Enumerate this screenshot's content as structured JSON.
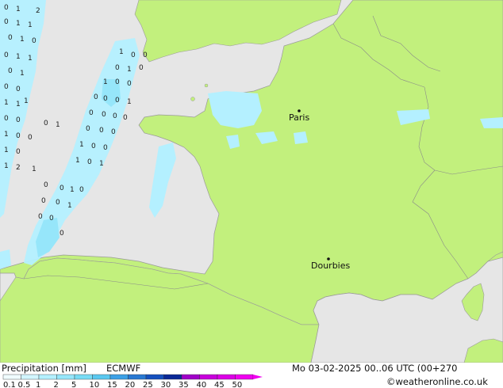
{
  "map": {
    "cities": [
      {
        "name": "Paris"
      },
      {
        "name": "Dourbies"
      }
    ],
    "precip_labels": [
      "0",
      "1",
      "2",
      "0",
      "1",
      "1",
      "0",
      "1",
      "0",
      "0",
      "1",
      "1",
      "0",
      "1",
      "0",
      "0",
      "1",
      "1",
      "1",
      "0",
      "0",
      "0",
      "1",
      "1",
      "0",
      "0",
      "1",
      "0",
      "1",
      "2",
      "1",
      "1",
      "0",
      "0",
      "0",
      "1",
      "0",
      "1",
      "0",
      "0",
      "0",
      "0",
      "0",
      "1",
      "0",
      "0",
      "0",
      "0",
      "0",
      "0",
      "0",
      "1",
      "0",
      "0",
      "1",
      "0",
      "1",
      "0",
      "0",
      "1",
      "0",
      "0",
      "0",
      "1",
      "0",
      "0",
      "0"
    ],
    "colors": {
      "land": "#c2f07d",
      "sea": "#e6e6e6",
      "precip_light": "#b4f0ff",
      "precip_med": "#7ee0f5"
    }
  },
  "footer": {
    "title": "Precipitation [mm]",
    "model": "ECMWF",
    "datetime": "Mo 03-02-2025 00..06 UTC (00+270",
    "credit": "©weatheronline.co.uk",
    "scale_labels": [
      "0.1",
      "0.5",
      "1",
      "2",
      "5",
      "10",
      "15",
      "20",
      "25",
      "30",
      "35",
      "40",
      "45",
      "50"
    ],
    "scale_colors": [
      "#f0fcff",
      "#d2f6ff",
      "#b4f0ff",
      "#96e6fa",
      "#78dcf5",
      "#5ac8f0",
      "#3ca0e6",
      "#2878d2",
      "#1450be",
      "#0a2896",
      "#a000c8",
      "#c800dc",
      "#dc00e6",
      "#f000f0"
    ]
  }
}
